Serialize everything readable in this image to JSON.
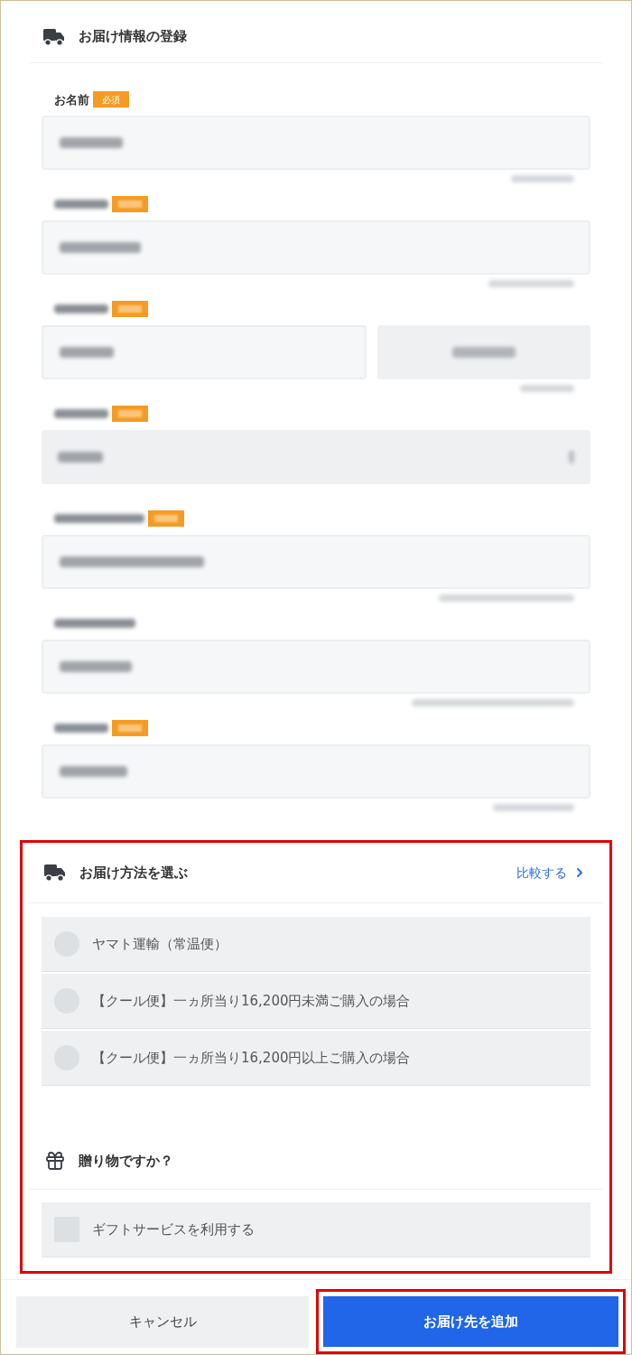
{
  "header": {
    "title": "お届け情報の登録"
  },
  "fields": [
    {
      "kind": "text",
      "label": "お名前",
      "badge": "必須",
      "required": true,
      "hint": true
    },
    {
      "kind": "text",
      "required": true,
      "hint": true
    },
    {
      "kind": "postal",
      "required": true,
      "hint": true
    },
    {
      "kind": "select",
      "required": true,
      "hint": false
    },
    {
      "kind": "text",
      "required": true,
      "hint": true
    },
    {
      "kind": "text",
      "required": false,
      "hint": true
    },
    {
      "kind": "text",
      "required": true,
      "hint": true
    }
  ],
  "delivery": {
    "highlighted": true,
    "title": "お届け方法を選ぶ",
    "compare_link": "比較する",
    "options": [
      {
        "label": "ヤマト運輸（常温便）",
        "selected": false
      },
      {
        "label": "【クール便】一ヵ所当り16,200円未満ご購入の場合",
        "selected": false
      },
      {
        "label": "【クール便】一ヵ所当り16,200円以上ご購入の場合",
        "selected": false
      }
    ]
  },
  "gift": {
    "title": "贈り物ですか？",
    "option": {
      "label": "ギフトサービスを利用する",
      "checked": false
    }
  },
  "footer": {
    "cancel": "キャンセル",
    "submit": {
      "label": "お届け先を追加",
      "highlighted": true
    }
  }
}
